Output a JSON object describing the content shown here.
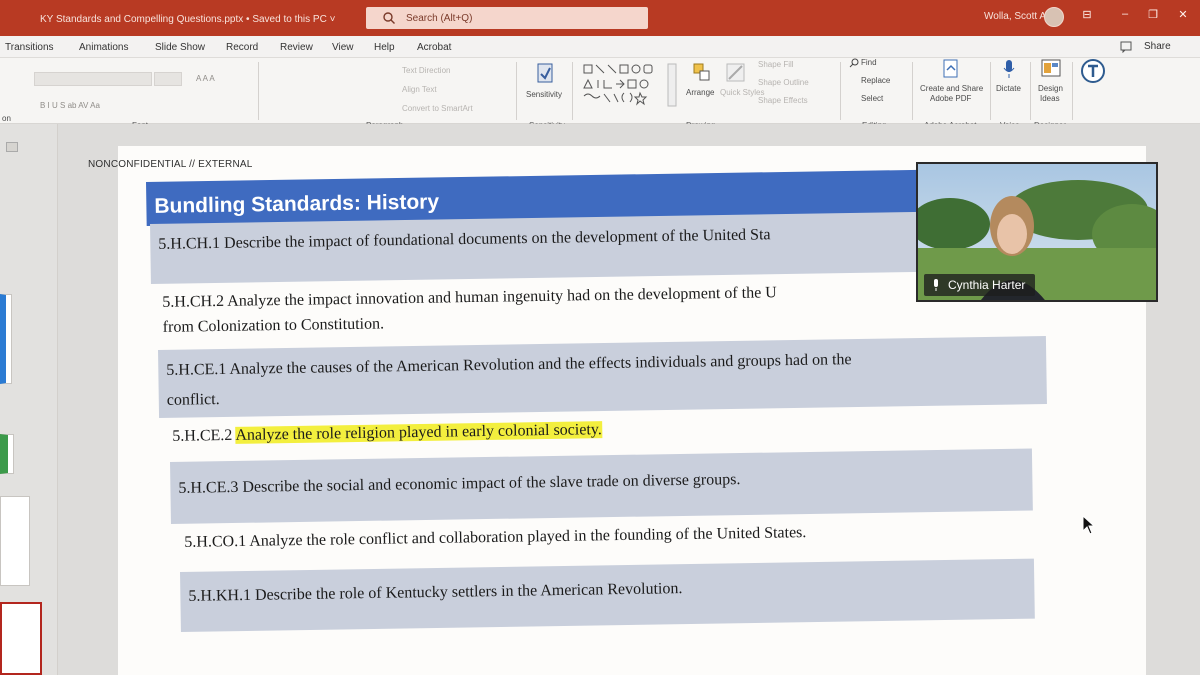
{
  "titlebar": {
    "doc_title": "KY Standards and Compelling Questions.pptx • Saved to this PC ˅",
    "search_placeholder": "Search (Alt+Q)",
    "user_name": "Wolla, Scott A",
    "minimize": "–",
    "restore": "❐",
    "close": "✕",
    "ribbon_toggle": "⊟"
  },
  "menu": {
    "tabs": [
      "Transitions",
      "Animations",
      "Slide Show",
      "Record",
      "Review",
      "View",
      "Help",
      "Acrobat"
    ],
    "share": "Share"
  },
  "ribbon": {
    "font_group": "Font",
    "paragraph_group": "Paragraph",
    "sensitivity_button": "Sensitivity",
    "sensitivity_group": "Sensitivity",
    "drawing_group": "Drawing",
    "arrange_button": "Arrange",
    "quick_styles_button": "Quick Styles",
    "shape_fill": "Shape Fill",
    "shape_outline": "Shape Outline",
    "shape_effects": "Shape Effects",
    "text_direction": "Text Direction",
    "align_text": "Align Text",
    "convert_smartart": "Convert to SmartArt",
    "find": "Find",
    "replace": "Replace",
    "select": "Select",
    "editing_group": "Editing",
    "create_share_pdf": [
      "Create and Share",
      "Adobe PDF"
    ],
    "adobe_group": "Adobe Acrobat",
    "dictate": "Dictate",
    "voice_group": "Voice",
    "design_ideas": [
      "Design",
      "Ideas"
    ],
    "designer_group": "Designer",
    "left_cut_label": "on",
    "font_buttons": "B  I  U  S  ab  AV  Aa",
    "font_size_buttons": "A  A  A"
  },
  "slide": {
    "classification": "NONCONFIDENTIAL // EXTERNAL",
    "title": "Bundling Standards: History",
    "rows": [
      {
        "lines": [
          "5.H.CH.1 Describe the impact of foundational documents on the development of the United Sta"
        ],
        "shaded": true
      },
      {
        "lines": [
          "5.H.CH.2 Analyze the impact innovation and human ingenuity had on the development of the U",
          "from Colonization to Constitution."
        ],
        "shaded": false
      },
      {
        "lines": [
          "5.H.CE.1 Analyze the causes of the American Revolution and the effects individuals and groups had on the",
          "conflict."
        ],
        "shaded": true
      },
      {
        "code": "5.H.CE.2",
        "highlight": "Analyze the role religion played in early colonial society.",
        "shaded": false
      },
      {
        "lines": [
          "5.H.CE.3 Describe the social and economic impact of the slave trade on diverse groups."
        ],
        "shaded": true
      },
      {
        "lines": [
          "5.H.CO.1 Analyze the role conflict and collaboration played in the founding of the United States."
        ],
        "shaded": false
      },
      {
        "lines": [
          "5.H.KH.1 Describe the role of Kentucky settlers in the American Revolution."
        ],
        "shaded": true
      }
    ]
  },
  "video": {
    "participant_name": "Cynthia Harter"
  }
}
